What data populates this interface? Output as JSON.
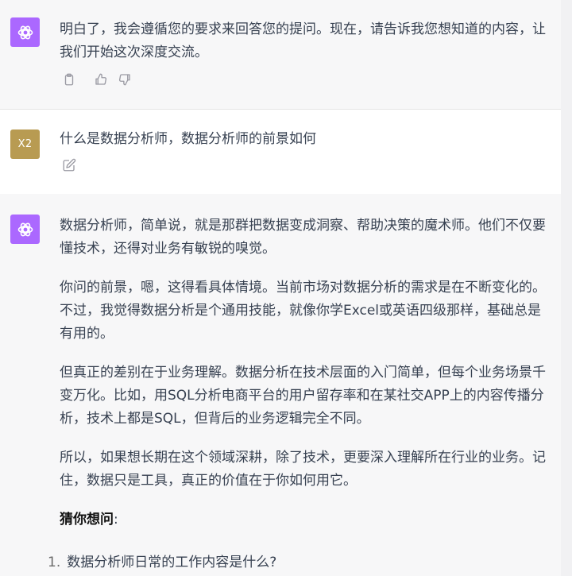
{
  "messages": [
    {
      "role": "assistant",
      "text": "明白了，我会遵循您的要求来回答您的提问。现在，请告诉我您想知道的内容，让我们开始这次深度交流。"
    },
    {
      "role": "user",
      "avatar_label": "X2",
      "text": "什么是数据分析师，数据分析师的前景如何"
    },
    {
      "role": "assistant",
      "paragraphs": [
        "数据分析师，简单说，就是那群把数据变成洞察、帮助决策的魔术师。他们不仅要懂技术，还得对业务有敏锐的嗅觉。",
        "你问的前景，嗯，这得看具体情境。当前市场对数据分析的需求是在不断变化的。不过，我觉得数据分析是个通用技能，就像你学Excel或英语四级那样，基础总是有用的。",
        "但真正的差别在于业务理解。数据分析在技术层面的入门简单，但每个业务场景千变万化。比如，用SQL分析电商平台的用户留存率和在某社交APP上的内容传播分析，技术上都是SQL，但背后的业务逻辑完全不同。",
        "所以，如果想长期在这个领域深耕，除了技术，更要深入理解所在行业的业务。记住，数据只是工具，真正的价值在于你如何用它。"
      ],
      "guess_heading": "猜你想问",
      "guess_colon": ":",
      "list": [
        {
          "num": "1.",
          "text": "数据分析师日常的工作内容是什么?"
        }
      ]
    }
  ],
  "colors": {
    "assistant_bg": "#f7f7f8",
    "user_bg": "#ffffff",
    "gpt_avatar": "#ab68ff",
    "user_avatar": "#b89b52"
  },
  "icons": [
    "openai-logo-icon",
    "clipboard-icon",
    "thumbs-up-icon",
    "thumbs-down-icon",
    "edit-icon"
  ]
}
